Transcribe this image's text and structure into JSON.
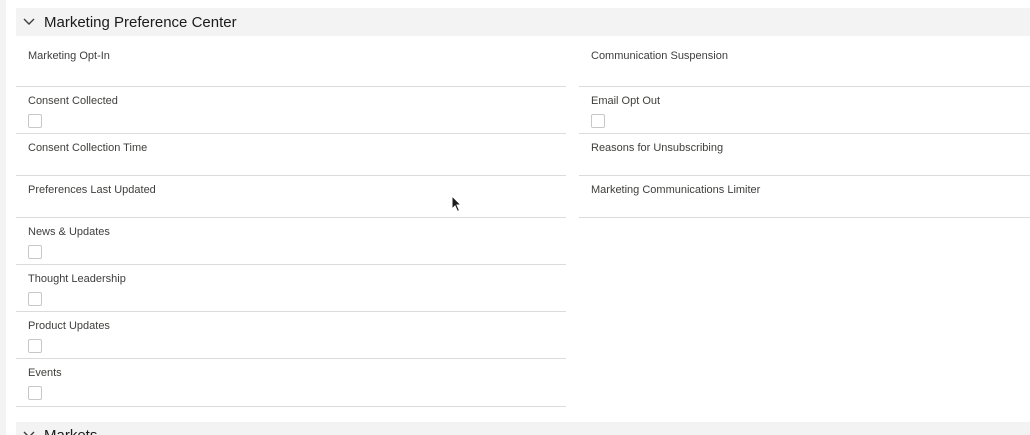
{
  "section": {
    "title": "Marketing Preference Center",
    "icon": "chevron-down-icon"
  },
  "left_fields": [
    {
      "label": "Marketing Opt-In",
      "type": "text",
      "value": ""
    },
    {
      "label": "Consent Collected",
      "type": "checkbox",
      "checked": false
    },
    {
      "label": "Consent Collection Time",
      "type": "text",
      "value": ""
    },
    {
      "label": "Preferences Last Updated",
      "type": "text",
      "value": ""
    },
    {
      "label": "News & Updates",
      "type": "checkbox",
      "checked": false
    },
    {
      "label": "Thought Leadership",
      "type": "checkbox",
      "checked": false
    },
    {
      "label": "Product Updates",
      "type": "checkbox",
      "checked": false
    },
    {
      "label": "Events",
      "type": "checkbox",
      "checked": false
    }
  ],
  "right_fields": [
    {
      "label": "Communication Suspension",
      "type": "text",
      "value": ""
    },
    {
      "label": "Email Opt Out",
      "type": "checkbox",
      "checked": false
    },
    {
      "label": "Reasons for Unsubscribing",
      "type": "text",
      "value": ""
    },
    {
      "label": "Marketing Communications Limiter",
      "type": "text",
      "value": ""
    }
  ],
  "next_section": {
    "title": "Markets"
  }
}
